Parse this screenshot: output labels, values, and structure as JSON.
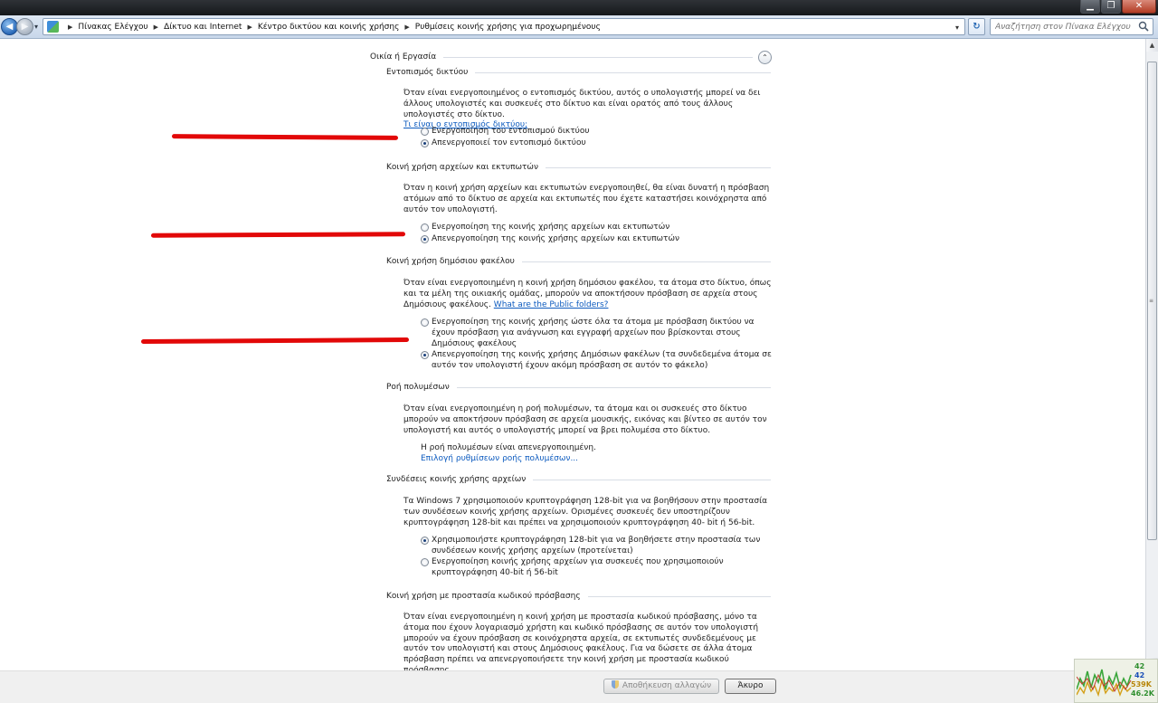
{
  "window": {
    "min_glyph": "▁",
    "max_glyph": "❐",
    "close_glyph": "✕"
  },
  "navigation": {
    "back_glyph": "◀",
    "forward_glyph": "▶",
    "dropdown_glyph": "▾",
    "refresh_glyph": "↻",
    "breadcrumbs": [
      "Πίνακας Ελέγχου",
      "Δίκτυο και Internet",
      "Κέντρο δικτύου και κοινής χρήσης",
      "Ρυθμίσεις κοινής χρήσης για προχωρημένους"
    ],
    "separator": "▶",
    "search_placeholder": "Αναζήτηση στον Πίνακα Ελέγχου"
  },
  "profile": {
    "title": "Οικία ή Εργασία",
    "collapse_glyph": "⌃"
  },
  "sections": {
    "discovery": {
      "heading": "Εντοπισμός δικτύου",
      "description": "Όταν είναι ενεργοποιημένος ο εντοπισμός δικτύου, αυτός ο υπολογιστής μπορεί να δει άλλους υπολογιστές και συσκευές στο δίκτυο και είναι ορατός από τους άλλους υπολογιστές στο δίκτυο.",
      "link": "Τι είναι ο εντοπισμός δικτύου;",
      "options": [
        {
          "label": "Ενεργοποίηση του εντοπισμού δικτύου",
          "selected": false
        },
        {
          "label": "Απενεργοποιεί τον εντοπισμό δικτύου",
          "selected": true
        }
      ]
    },
    "file_printer": {
      "heading": "Κοινή χρήση αρχείων και εκτυπωτών",
      "description": "Όταν η κοινή χρήση αρχείων και εκτυπωτών ενεργοποιηθεί, θα είναι δυνατή η πρόσβαση ατόμων από το δίκτυο σε αρχεία και εκτυπωτές που έχετε καταστήσει κοινόχρηστα από αυτόν τον υπολογιστή.",
      "options": [
        {
          "label": "Ενεργοποίηση της κοινής χρήσης αρχείων και εκτυπωτών",
          "selected": false
        },
        {
          "label": "Απενεργοποίηση της κοινής χρήσης αρχείων και εκτυπωτών",
          "selected": true
        }
      ]
    },
    "public_folder": {
      "heading": "Κοινή χρήση δημόσιου φακέλου",
      "description": "Όταν είναι ενεργοποιημένη η κοινή χρήση δημόσιου φακέλου, τα άτομα στο δίκτυο, όπως και τα μέλη της οικιακής  ομάδας, μπορούν να αποκτήσουν πρόσβαση σε αρχεία στους Δημόσιους φακέλους.",
      "link": "What are the Public folders?",
      "options": [
        {
          "label": "Ενεργοποίηση της κοινής χρήσης ώστε όλα τα άτομα με πρόσβαση δικτύου να έχουν πρόσβαση για ανάγνωση και εγγραφή αρχείων που βρίσκονται στους Δημόσιους φακέλους",
          "selected": false
        },
        {
          "label": "Απενεργοποίηση της κοινής χρήσης Δημόσιων φακέλων (τα συνδεδεμένα άτομα σε αυτόν τον υπολογιστή έχουν ακόμη πρόσβαση σε αυτόν το φάκελο)",
          "selected": true
        }
      ]
    },
    "media": {
      "heading": "Ροή πολυμέσων",
      "description": "Όταν είναι ενεργοποιημένη η ροή πολυμέσων, τα άτομα και οι συσκευές στο δίκτυο μπορούν να αποκτήσουν πρόσβαση σε αρχεία μουσικής, εικόνας και βίντεο σε αυτόν τον υπολογιστή και αυτός ο υπολογιστής μπορεί να βρει πολυμέσα στο δίκτυο.",
      "status": "Η ροή πολυμέσων είναι απενεργοποιημένη.",
      "link": "Επιλογή ρυθμίσεων ροής πολυμέσων..."
    },
    "connections": {
      "heading": "Συνδέσεις κοινής χρήσης αρχείων",
      "description": "Τα Windows 7 χρησιμοποιούν κρυπτογράφηση 128-bit για να βοηθήσουν στην προστασία των συνδέσεων κοινής χρήσης αρχείων. Ορισμένες συσκευές δεν υποστηρίζουν κρυπτογράφηση 128-bit και πρέπει να χρησιμοποιούν κρυπτογράφηση 40- bit ή 56-bit.",
      "options": [
        {
          "label": "Χρησιμοποιήστε κρυπτογράφηση 128-bit για να βοηθήσετε στην προστασία των συνδέσεων κοινής χρήσης αρχείων (προτείνεται)",
          "selected": true
        },
        {
          "label": "Ενεργοποίηση κοινής χρήσης αρχείων για συσκευές που χρησιμοποιούν κρυπτογράφηση 40-bit ή 56-bit",
          "selected": false
        }
      ]
    },
    "password": {
      "heading": "Κοινή χρήση με προστασία κωδικού πρόσβασης",
      "description": "Όταν είναι ενεργοποιημένη η κοινή χρήση με προστασία κωδικού πρόσβασης, μόνο τα άτομα που έχουν λογαριασμό χρήστη και κωδικό πρόσβασης σε αυτόν τον υπολογιστή μπορούν να έχουν πρόσβαση σε κοινόχρηστα αρχεία, σε εκτυπωτές συνδεδεμένους με αυτόν τον υπολογιστή και στους Δημόσιους φακέλους. Για να δώσετε σε άλλα άτομα πρόσβαση πρέπει να απενεργοποιήσετε την κοινή χρήση με προστασία κωδικού πρόσβασης."
    }
  },
  "footer": {
    "save_label": "Αποθήκευση αλλαγών",
    "cancel_label": "Άκυρο"
  },
  "scrollbar": {
    "position_fraction": 0.08,
    "visible_fraction": 0.79
  },
  "gadget": {
    "values": [
      "42",
      "42",
      "539K",
      "46.2K"
    ],
    "colors": [
      "#2f8f2f",
      "#1a4fb8",
      "#b8860b",
      "#2f8f2f"
    ]
  },
  "colors": {
    "link": "#0d5bbf",
    "annotation_red": "#e20808"
  }
}
